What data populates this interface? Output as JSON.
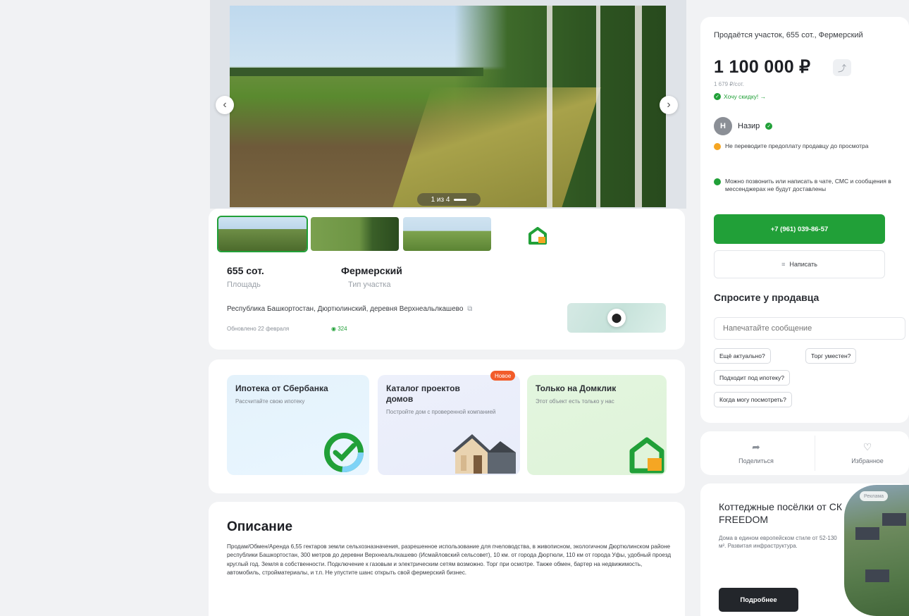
{
  "gallery": {
    "counter": "1 из 4",
    "prev_icon": "chevron-left-icon",
    "next_icon": "chevron-right-icon"
  },
  "params": {
    "area_value": "655 сот.",
    "area_label": "Площадь",
    "type_value": "Фермерский",
    "type_label": "Тип участка"
  },
  "address": "Республика Башкортостан, Дюртюлинский, деревня Верхнеальлкашево",
  "updated": "Обновлено 22 февраля",
  "views": "324",
  "promo": [
    {
      "title": "Ипотека от Сбербанка",
      "subtitle": "Рассчитайте свою ипотеку"
    },
    {
      "title": "Каталог проектов домов",
      "subtitle": "Постройте дом с проверенной компанией",
      "badge": "Новое"
    },
    {
      "title": "Только на Домклик",
      "subtitle": "Этот объект есть только у нас"
    }
  ],
  "description": {
    "title": "Описание",
    "text": "Продам/Обмен/Аренда 6,55 гектаров земли сельхозназначения, разрешенное использование для пчеловодства, в живописном, экологичном Дюртюлинском районе республики Башкортостан, 300 метров до деревни Верхнеальлкашево (Исмайловский сельсовет), 10 км. от города Дюртюли, 110 км от города Уфы, удобный проезд круглый год. Земля в собственности. Подключение к газовым и электрическим сетям возможно. Торг при осмотре. Также обмен, бартер на недвижимость, автомобиль, стройматериалы, и т.п. Не упустите шанс открыть свой фермерский бизнес."
  },
  "offer": {
    "title": "Продаётся участок, 655 сот., Фермерский",
    "price": "1 100 000 ₽",
    "price_per": "1 679 ₽/сот.",
    "discount_link": "Хочу скидку! →"
  },
  "seller": {
    "initial": "Н",
    "name": "Назир"
  },
  "warnings": [
    {
      "text": "Не переводите предоплату продавцу до просмотра",
      "color": "#f5a623"
    },
    {
      "text": "Можно позвонить или написать в чате, СМС и сообщения в мессенджерах не будут доставлены",
      "color": "#21a038"
    }
  ],
  "buttons": {
    "phone": "+7 (961) 039-86-57",
    "write": "Написать"
  },
  "ask": {
    "title": "Спросите у продавца",
    "placeholder": "Напечатайте сообщение",
    "chips": [
      "Ещё актуально?",
      "Торг уместен?",
      "Подходит под ипотеку?",
      "Когда могу посмотреть?"
    ]
  },
  "actions": {
    "share": "Поделиться",
    "favorite": "Избранное"
  },
  "ad": {
    "title": "Коттеджные посёлки от СК FREEDOM",
    "text": "Дома в едином европейском стиле от 52-130 м². Развитая инфраструктура.",
    "badge": "Реклама",
    "button": "Подробнее"
  },
  "colors": {
    "accent": "#21a038",
    "new_badge": "#f25c2a"
  }
}
